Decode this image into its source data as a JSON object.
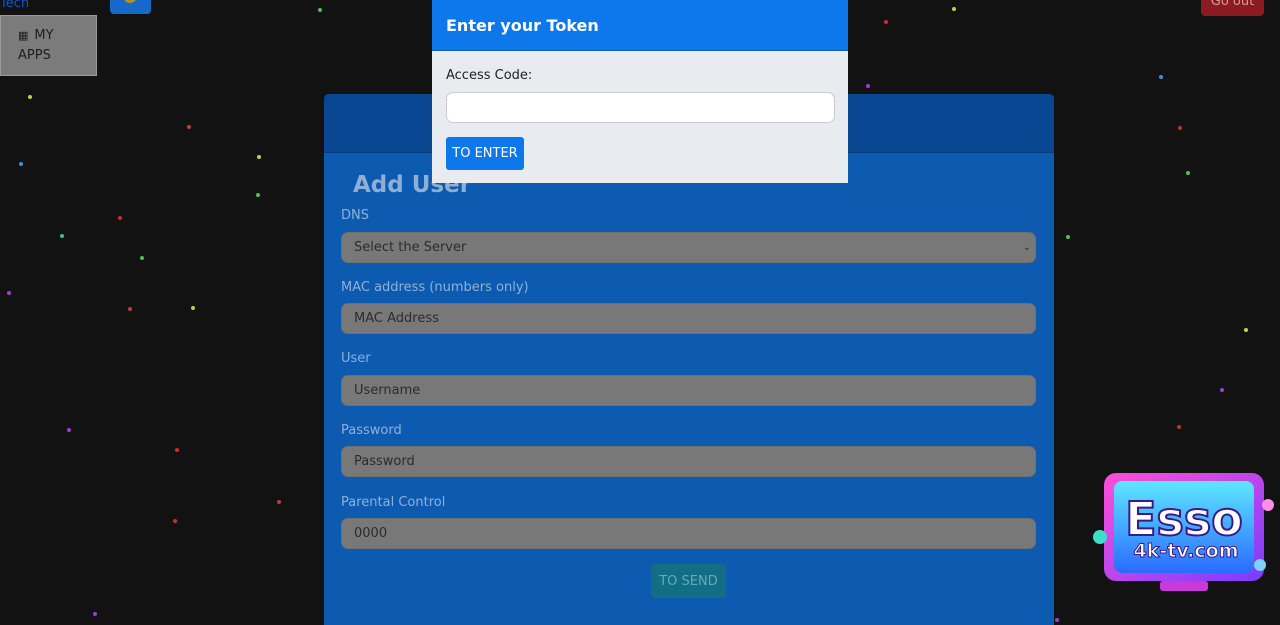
{
  "header": {
    "brand": "Tech",
    "apps_icon": "grid-icon",
    "apps_label_line1": "MY",
    "apps_label_line2": "APPS",
    "logout_label": "Go out"
  },
  "form": {
    "title": "Add User",
    "dns_label": "DNS",
    "dns_selected": "Select the Server",
    "mac_label": "MAC address (numbers only)",
    "mac_placeholder": "MAC Address",
    "user_label": "User",
    "user_placeholder": "Username",
    "password_label": "Password",
    "password_placeholder": "Password",
    "parental_label": "Parental Control",
    "parental_value": "0000",
    "send_label": "TO SEND"
  },
  "modal": {
    "title": "Enter your Token",
    "field_label": "Access Code:",
    "field_value": "",
    "button_label": "TO ENTER"
  },
  "watermark": {
    "line1": "Esso",
    "line2": "4k-tv.com"
  },
  "colors": {
    "accent": "#0d78ec",
    "card": "#0c5bb1",
    "danger": "#8b1a22"
  }
}
